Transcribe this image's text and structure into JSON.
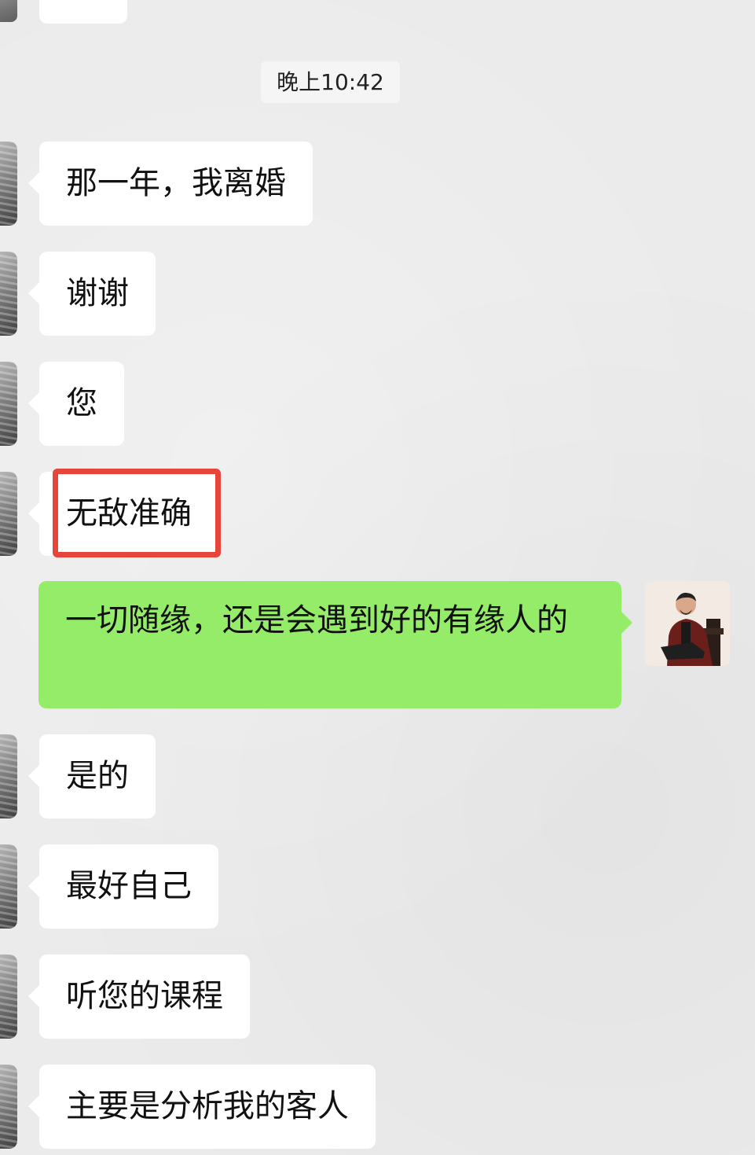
{
  "timestamp": "晚上10:42",
  "messages": [
    {
      "side": "left",
      "text": "那一年，我离婚"
    },
    {
      "side": "left",
      "text": "谢谢"
    },
    {
      "side": "left",
      "text": "您"
    },
    {
      "side": "left",
      "text": "无敌准确",
      "highlighted": true
    },
    {
      "side": "right",
      "text": "一切随缘，还是会遇到好的有缘人的"
    },
    {
      "side": "left",
      "text": "是的"
    },
    {
      "side": "left",
      "text": "最好自己"
    },
    {
      "side": "left",
      "text": "听您的课程"
    },
    {
      "side": "left",
      "text": "主要是分析我的客人"
    }
  ],
  "colors": {
    "background": "#ebebeb",
    "incoming_bubble": "#ffffff",
    "outgoing_bubble": "#95ec69",
    "highlight_border": "#e5453a"
  },
  "icons": {
    "contact_avatar": "contact-avatar-icon",
    "my_avatar": "user-avatar-icon"
  }
}
